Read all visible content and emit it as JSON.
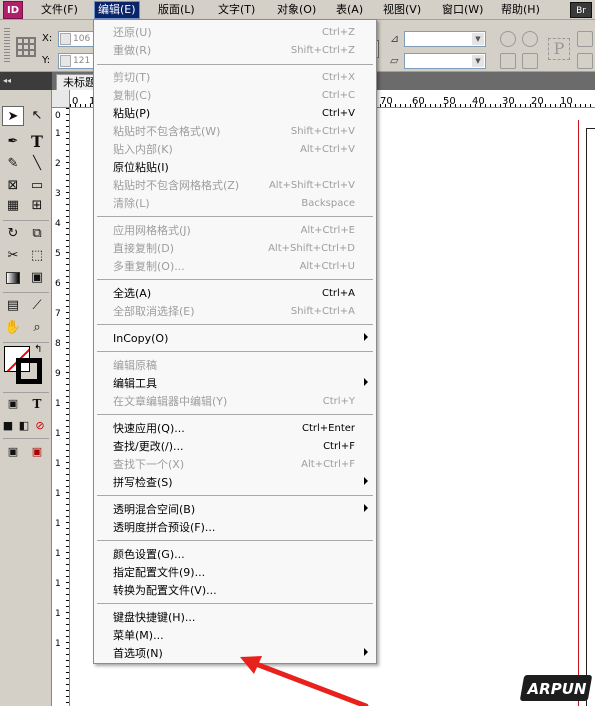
{
  "menubar": {
    "logo": "ID",
    "items": [
      "文件(F)",
      "编辑(E)",
      "版面(L)",
      "文字(T)",
      "对象(O)",
      "表(A)",
      "视图(V)",
      "窗口(W)",
      "帮助(H)"
    ],
    "active_index": 1,
    "bridge_label": "Br"
  },
  "controlbar": {
    "x_label": "X:",
    "x_value": "106",
    "y_label": "Y:",
    "y_value": "121",
    "ref_label": "P"
  },
  "tabs": {
    "document_tab": "未标题"
  },
  "ruler": {
    "h_ticks": [
      "0",
      "1",
      "70",
      "60",
      "50",
      "40",
      "30",
      "20",
      "10"
    ],
    "v_ticks": [
      "0",
      "1",
      "2",
      "3",
      "4",
      "5",
      "6",
      "7",
      "8",
      "9",
      "1",
      "1",
      "1",
      "1",
      "1",
      "1",
      "1",
      "1",
      "1"
    ]
  },
  "toolbox": {
    "tools": [
      "selection-tool",
      "direct-selection-tool",
      "pen-tool",
      "type-tool",
      "pencil-tool",
      "line-tool",
      "rectangle-frame-tool",
      "rectangle-tool",
      "table-tool",
      "grid-tool",
      "rotate-tool",
      "scale-tool",
      "scissors-tool",
      "free-transform-tool",
      "gradient-tool",
      "image-tool",
      "note-tool",
      "eyedropper-tool",
      "hand-tool",
      "zoom-tool"
    ],
    "format_text_label": "T"
  },
  "edit_menu": {
    "items": [
      {
        "label": "还原(U)",
        "shortcut": "Ctrl+Z",
        "disabled": true
      },
      {
        "label": "重做(R)",
        "shortcut": "Shift+Ctrl+Z",
        "disabled": true
      },
      {
        "label": "剪切(T)",
        "shortcut": "Ctrl+X",
        "disabled": true
      },
      {
        "label": "复制(C)",
        "shortcut": "Ctrl+C",
        "disabled": true
      },
      {
        "label": "粘贴(P)",
        "shortcut": "Ctrl+V",
        "disabled": false
      },
      {
        "label": "粘贴时不包含格式(W)",
        "shortcut": "Shift+Ctrl+V",
        "disabled": true
      },
      {
        "label": "贴入内部(K)",
        "shortcut": "Alt+Ctrl+V",
        "disabled": true
      },
      {
        "label": "原位粘贴(I)",
        "shortcut": "",
        "disabled": false
      },
      {
        "label": "粘贴时不包含网格格式(Z)",
        "shortcut": "Alt+Shift+Ctrl+V",
        "disabled": true
      },
      {
        "label": "清除(L)",
        "shortcut": "Backspace",
        "disabled": true
      },
      {
        "label": "应用网格格式(J)",
        "shortcut": "Alt+Ctrl+E",
        "disabled": true
      },
      {
        "label": "直接复制(D)",
        "shortcut": "Alt+Shift+Ctrl+D",
        "disabled": true
      },
      {
        "label": "多重复制(O)...",
        "shortcut": "Alt+Ctrl+U",
        "disabled": true
      },
      {
        "label": "全选(A)",
        "shortcut": "Ctrl+A",
        "disabled": false
      },
      {
        "label": "全部取消选择(E)",
        "shortcut": "Shift+Ctrl+A",
        "disabled": true
      },
      {
        "label": "InCopy(O)",
        "shortcut": "",
        "disabled": false,
        "submenu": true
      },
      {
        "label": "编辑原稿",
        "shortcut": "",
        "disabled": true
      },
      {
        "label": "编辑工具",
        "shortcut": "",
        "disabled": false,
        "submenu": true
      },
      {
        "label": "在文章编辑器中编辑(Y)",
        "shortcut": "Ctrl+Y",
        "disabled": true
      },
      {
        "label": "快速应用(Q)...",
        "shortcut": "Ctrl+Enter",
        "disabled": false
      },
      {
        "label": "查找/更改(/)...",
        "shortcut": "Ctrl+F",
        "disabled": false
      },
      {
        "label": "查找下一个(X)",
        "shortcut": "Alt+Ctrl+F",
        "disabled": true
      },
      {
        "label": "拼写检查(S)",
        "shortcut": "",
        "disabled": false,
        "submenu": true
      },
      {
        "label": "透明混合空间(B)",
        "shortcut": "",
        "disabled": false,
        "submenu": true
      },
      {
        "label": "透明度拼合预设(F)...",
        "shortcut": "",
        "disabled": false
      },
      {
        "label": "颜色设置(G)...",
        "shortcut": "",
        "disabled": false
      },
      {
        "label": "指定配置文件(9)...",
        "shortcut": "",
        "disabled": false
      },
      {
        "label": "转换为配置文件(V)...",
        "shortcut": "",
        "disabled": false
      },
      {
        "label": "键盘快捷键(H)...",
        "shortcut": "",
        "disabled": false
      },
      {
        "label": "菜单(M)...",
        "shortcut": "",
        "disabled": false
      },
      {
        "label": "首选项(N)",
        "shortcut": "",
        "disabled": false,
        "submenu": true
      }
    ]
  },
  "annotation": {
    "color": "#e8211d",
    "points_to": "首选项(N)"
  },
  "watermark": {
    "text": "ARPUN"
  }
}
